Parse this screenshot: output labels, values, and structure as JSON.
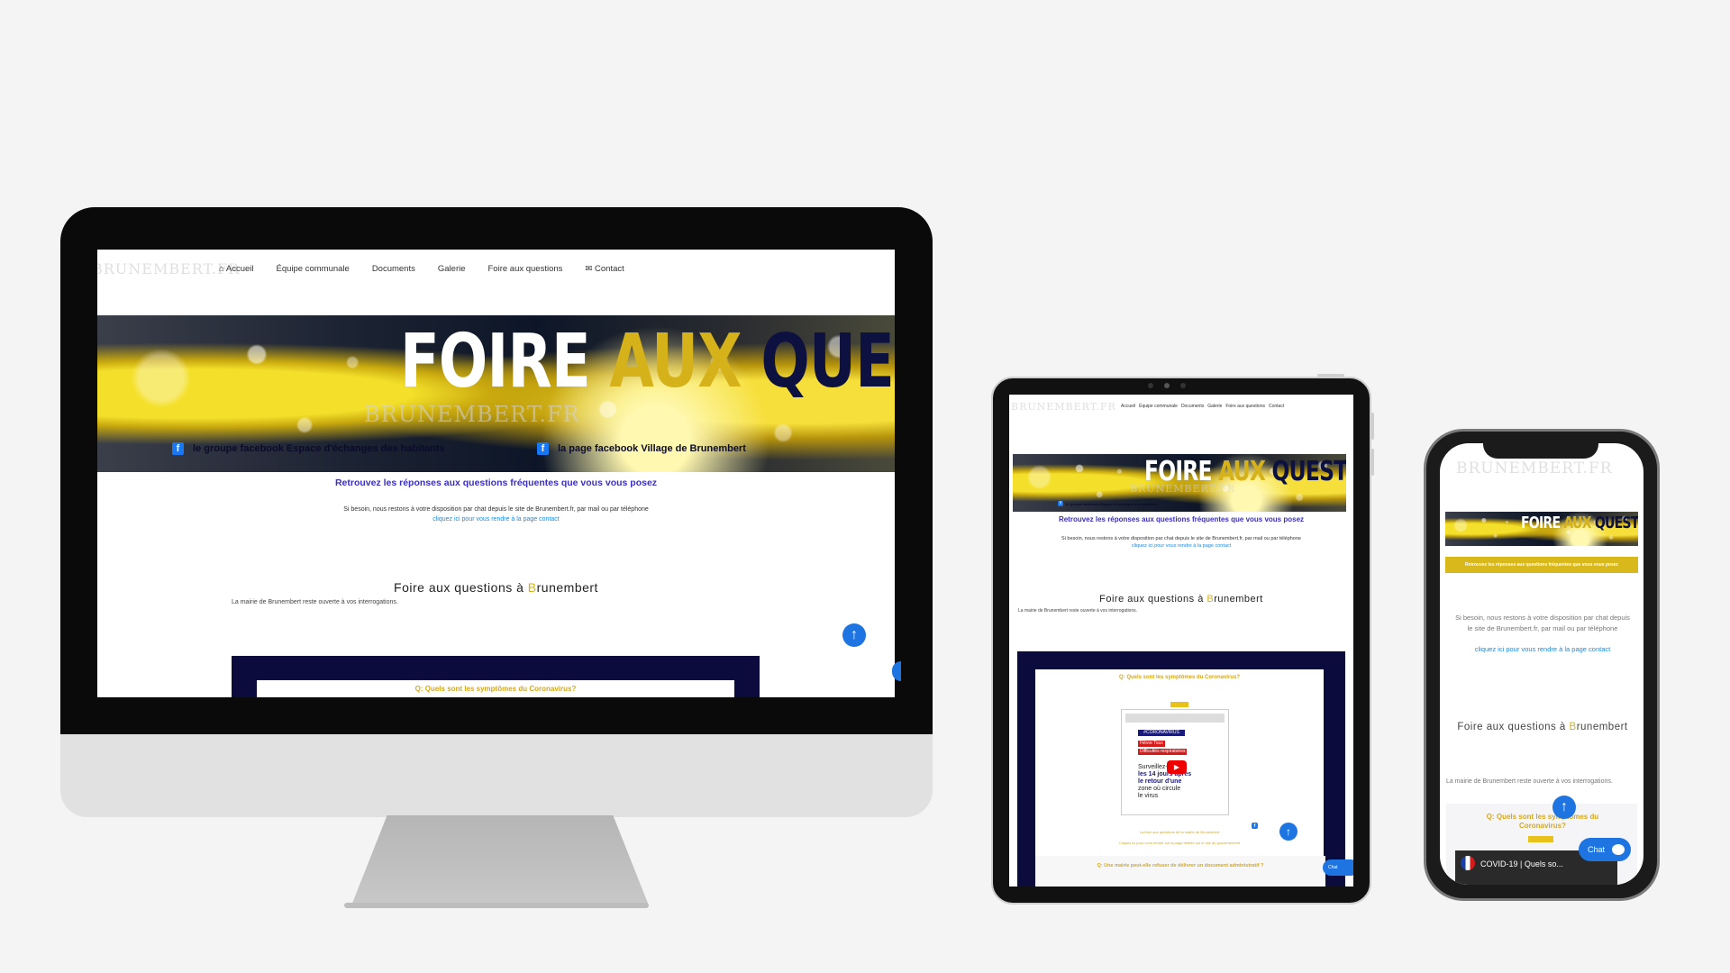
{
  "site": {
    "logo": "BRUNEMBERT.FR",
    "nav": [
      "Accueil",
      "Équipe communale",
      "Documents",
      "Galerie",
      "Foire aux questions",
      "Contact"
    ],
    "banner": {
      "title_w1": "FOIRE",
      "title_w2": "AUX",
      "title_w3": "QUESTIONS",
      "watermark": "BRUNEMBERT.FR"
    },
    "fb_group_prefix": "le groupe facebook",
    "fb_group_name": "Espace d'échanges des habitants",
    "fb_page_prefix": "la page facebook",
    "fb_page_name": "Village de Brunembert",
    "intro_title": "Retrouvez les réponses aux questions fréquentes que vous vous posez",
    "intro_text": "Si besoin, nous restons à votre disposition par chat depuis le site de Brunembert.fr, par mail ou par téléphone",
    "intro_link": "cliquez ici pour vous rendre à la page contact",
    "faq_title_prefix": "Foire aux questions à ",
    "faq_title_B": "B",
    "faq_title_rest": "runembert",
    "faq_sub": "La mairie de Brunembert reste ouverte à vos interrogations.",
    "q1": "Q: Quels sont les symptômes du Coronavirus?",
    "q2": "Q: Une mairie peut-elle refuser de délivrer un document administratif ?",
    "video": {
      "badge": "#CORONAVIRUS",
      "tag1": "Fièvre",
      "tag2": "Toux",
      "tag3": "Difficultés respiratoires",
      "line1": "Surveillez-les",
      "line2": "les 14 jours après",
      "line3": "le retour d'une",
      "line4": "zone où circule",
      "line5": "le virus",
      "title": "COVID-19 | Quels so..."
    },
    "caption1": "La foire aux questions de la mairie de Brunembert",
    "caption2": "Cliquez ici pour vous rendre sur la page dédiée sur le site du gouvernement",
    "chat_label": "Chat",
    "up_icon": "↑"
  },
  "colors": {
    "navy": "#0b0c3d",
    "gold": "#d6b21a",
    "link": "#1a8be0",
    "blue_button": "#1e74e0"
  }
}
